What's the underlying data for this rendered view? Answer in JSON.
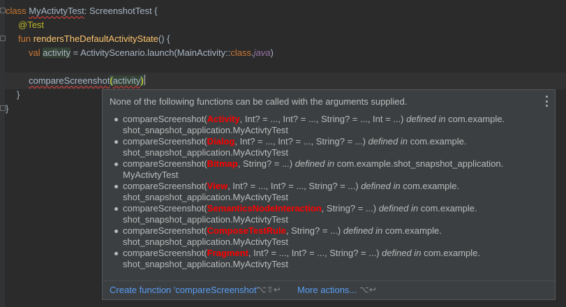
{
  "code": {
    "line1": {
      "kw": "class",
      "name": "MyActivtyTest",
      "colon": ": ",
      "parent": "ScreenshotTest",
      "brace": " {"
    },
    "line2": {
      "annotation": "@Test"
    },
    "line3": {
      "kw": "fun",
      "name": "rendersTheDefaultActivityState",
      "tail": "() {"
    },
    "line4": {
      "kw": "val",
      "var": "activity",
      "eq": " = ActivityScenario.launch(MainActivity::",
      "kw2": "class",
      "dot": ".",
      "java": "java",
      "close": ")"
    },
    "line6": {
      "call": "compareScreenshot",
      "open": "(",
      "arg": "activity",
      "close": ")"
    },
    "line7": {
      "brace": "}"
    },
    "line8": {
      "brace": "}"
    }
  },
  "popup": {
    "header": "None of the following functions can be called with the arguments supplied.",
    "defined_in": "defined in",
    "overloads": [
      {
        "name": "compareScreenshot(",
        "bad_type": "Activity",
        "params": ", Int? = ..., Int? = ..., String? = ..., Int = ...)",
        "location_a": "com.example.",
        "location_b": "shot_snapshot_application.MyActivtyTest"
      },
      {
        "name": "compareScreenshot(",
        "bad_type": "Dialog",
        "params": ", Int? = ..., Int? = ..., String? = ...)",
        "location_a": "com.example.",
        "location_b": "shot_snapshot_application.MyActivtyTest"
      },
      {
        "name": "compareScreenshot(",
        "bad_type": "Bitmap",
        "params": ", String? = ...)",
        "location_a": "com.example.shot_snapshot_application.",
        "location_b": "MyActivtyTest"
      },
      {
        "name": "compareScreenshot(",
        "bad_type": "View",
        "params": ", Int? = ..., Int? = ..., String? = ...)",
        "location_a": "com.example.",
        "location_b": "shot_snapshot_application.MyActivtyTest"
      },
      {
        "name": "compareScreenshot(",
        "bad_type": "SemanticsNodeInteraction",
        "params": ", String? = ...)",
        "location_a": "com.example.",
        "location_b": "shot_snapshot_application.MyActivtyTest"
      },
      {
        "name": "compareScreenshot(",
        "bad_type": "ComposeTestRule",
        "params": ", String? = ...)",
        "location_a": "com.example.",
        "location_b": "shot_snapshot_application.MyActivtyTest"
      },
      {
        "name": "compareScreenshot(",
        "bad_type": "Fragment",
        "params": ", Int? = ..., Int? = ..., String? = ...)",
        "location_a": "com.example.",
        "location_b": "shot_snapshot_application.MyActivtyTest"
      }
    ],
    "footer": {
      "create_label": "Create function 'compareScreenshot'",
      "create_shortcut": "⌥⇧↩",
      "more_label": "More actions...",
      "more_shortcut": "⌥↩"
    },
    "menu_icon": "vertical-ellipsis-icon"
  },
  "colors": {
    "editor_bg": "#2b2b2b",
    "popup_bg": "#3c3f41",
    "keyword": "#cc7832",
    "function": "#ffc66d",
    "annotation": "#bbb529",
    "error": "#ff0000",
    "link": "#589df6"
  }
}
